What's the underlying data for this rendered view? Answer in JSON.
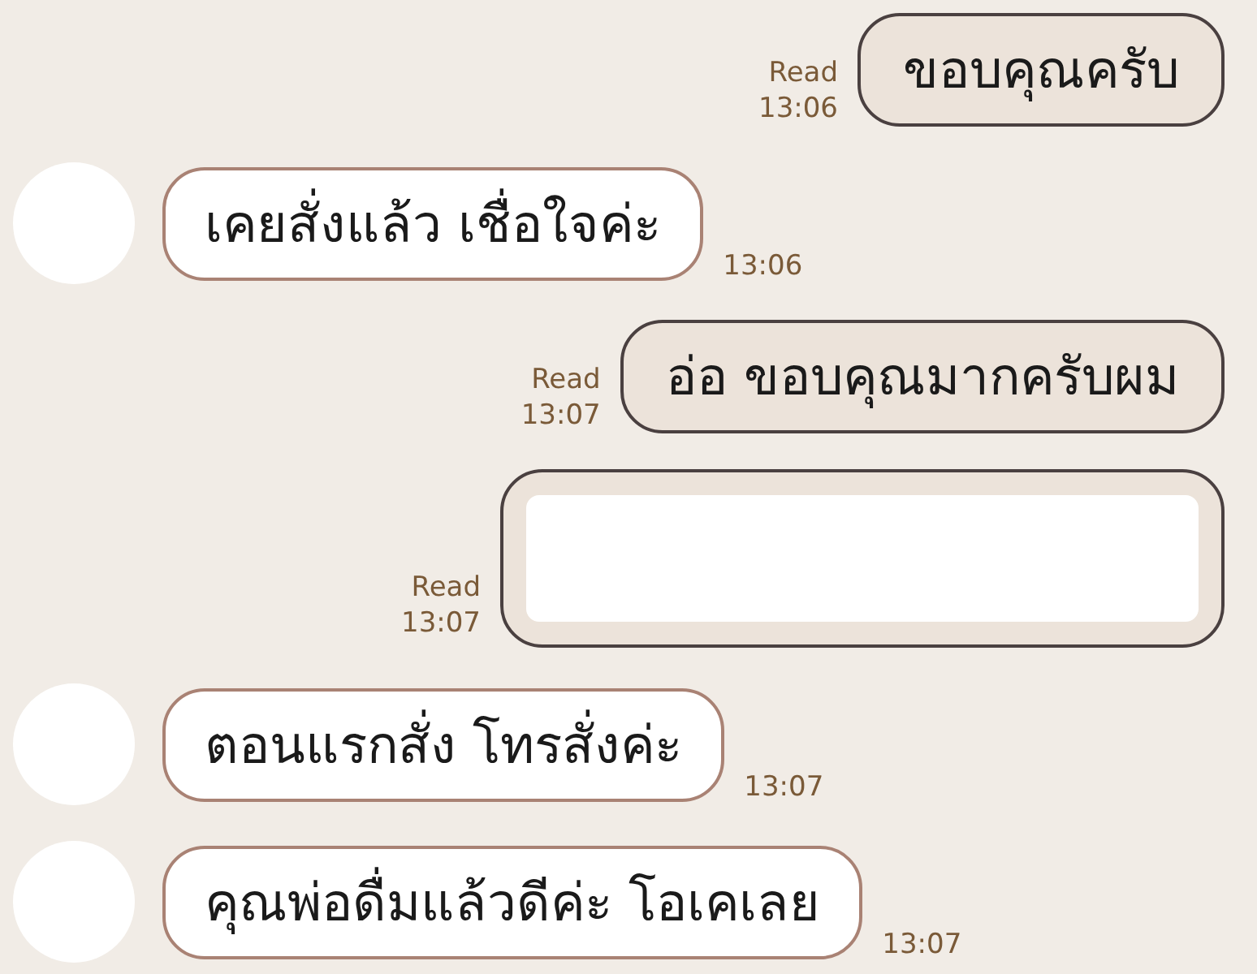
{
  "messages": [
    {
      "kind": "sent",
      "text": "ขอบคุณครับ",
      "read": "Read",
      "time": "13:06"
    },
    {
      "kind": "received",
      "text": "เคยสั่งแล้ว เชื่อใจค่ะ",
      "time": "13:06"
    },
    {
      "kind": "sent",
      "text": "อ่อ ขอบคุณมากครับผม",
      "read": "Read",
      "time": "13:07"
    },
    {
      "kind": "redacted",
      "read": "Read",
      "time": "13:07"
    },
    {
      "kind": "received",
      "text": "ตอนแรกสั่ง โทรสั่งค่ะ",
      "time": "13:07"
    },
    {
      "kind": "received",
      "text": "คุณพ่อดื่มแล้วดีค่ะ โอเคเลย",
      "time": "13:07"
    }
  ]
}
